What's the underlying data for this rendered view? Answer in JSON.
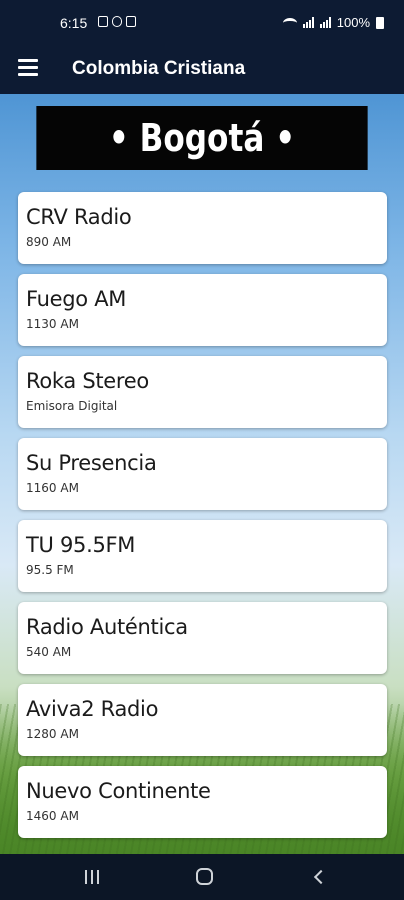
{
  "status_bar": {
    "time": "6:15",
    "battery": "100%"
  },
  "app_bar": {
    "title": "Colombia Cristiana"
  },
  "banner": {
    "city": "• Bogotá •"
  },
  "stations": [
    {
      "name": "CRV Radio",
      "frequency": "890 AM"
    },
    {
      "name": "Fuego AM",
      "frequency": "1130 AM"
    },
    {
      "name": "Roka Stereo",
      "frequency": "Emisora Digital"
    },
    {
      "name": "Su Presencia",
      "frequency": "1160 AM"
    },
    {
      "name": "TU 95.5FM",
      "frequency": "95.5 FM"
    },
    {
      "name": "Radio Auténtica",
      "frequency": "540 AM"
    },
    {
      "name": "Aviva2 Radio",
      "frequency": "1280 AM"
    },
    {
      "name": "Nuevo Continente",
      "frequency": "1460 AM"
    }
  ],
  "colors": {
    "app_bar": "#0d1b33",
    "banner": "#050505",
    "card": "#ffffff"
  }
}
